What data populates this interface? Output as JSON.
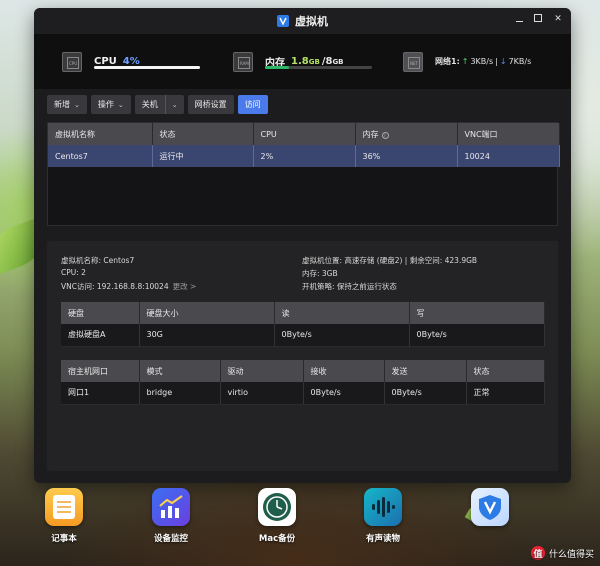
{
  "window": {
    "title": "虚拟机",
    "icon": "v-shield-icon"
  },
  "stats": {
    "cpu": {
      "label": "CPU",
      "value": "4%",
      "bar_fraction": 0.04,
      "icon": "cpu-chip-icon",
      "icon_text": "CPU"
    },
    "memory": {
      "label": "内存",
      "used": "1.8",
      "used_unit": "GB",
      "separator": "/",
      "total": "8",
      "total_unit": "GB",
      "bar_fraction": 0.225,
      "icon": "ram-chip-icon",
      "icon_text": "RAM"
    },
    "network": {
      "label": "网络1:",
      "up_arrow": "↑",
      "up": "3KB/s",
      "sep": "|",
      "down_arrow": "↓",
      "down": "7KB/s",
      "icon": "network-icon",
      "icon_text": "NET"
    }
  },
  "toolbar": {
    "new_label": "新增",
    "operate_label": "操作",
    "shutdown_label": "关机",
    "netsettings_label": "网桥设置",
    "access_label": "访问"
  },
  "vm_table": {
    "columns": [
      "虚拟机名称",
      "状态",
      "CPU",
      "内存",
      "VNC端口"
    ],
    "rows": [
      [
        "Centos7",
        "运行中",
        "2%",
        "36%",
        "10024"
      ]
    ]
  },
  "details": {
    "name": "虚拟机名称: Centos7",
    "cpu": "CPU: 2",
    "vnc": "VNC访问: 192.168.8.8:10024",
    "change_link": "更改 >",
    "location": "虚拟机位置: 高速存储 (硬盘2) | 剩余空间: 423.9GB",
    "memory": "内存: 3GB",
    "boot_policy": "开机策略: 保持之前运行状态"
  },
  "disk_table": {
    "columns": [
      "硬盘",
      "硬盘大小",
      "读",
      "写"
    ],
    "rows": [
      [
        "虚拟硬盘A",
        "30G",
        "0Byte/s",
        "0Byte/s"
      ]
    ]
  },
  "net_table": {
    "columns": [
      "宿主机网口",
      "模式",
      "驱动",
      "接收",
      "发送",
      "状态"
    ],
    "rows": [
      [
        "网口1",
        "bridge",
        "virtio",
        "0Byte/s",
        "0Byte/s",
        "正常"
      ]
    ]
  },
  "dock": [
    {
      "label": "记事本",
      "icon": "notepad-icon"
    },
    {
      "label": "设备监控",
      "icon": "chart-monitor-icon"
    },
    {
      "label": "Mac备份",
      "icon": "time-machine-icon"
    },
    {
      "label": "有声读物",
      "icon": "audio-wave-icon"
    },
    {
      "label": "",
      "icon": "v-shield-app-icon"
    }
  ],
  "watermark": {
    "text": "什么值得买",
    "logo_char": "值"
  }
}
